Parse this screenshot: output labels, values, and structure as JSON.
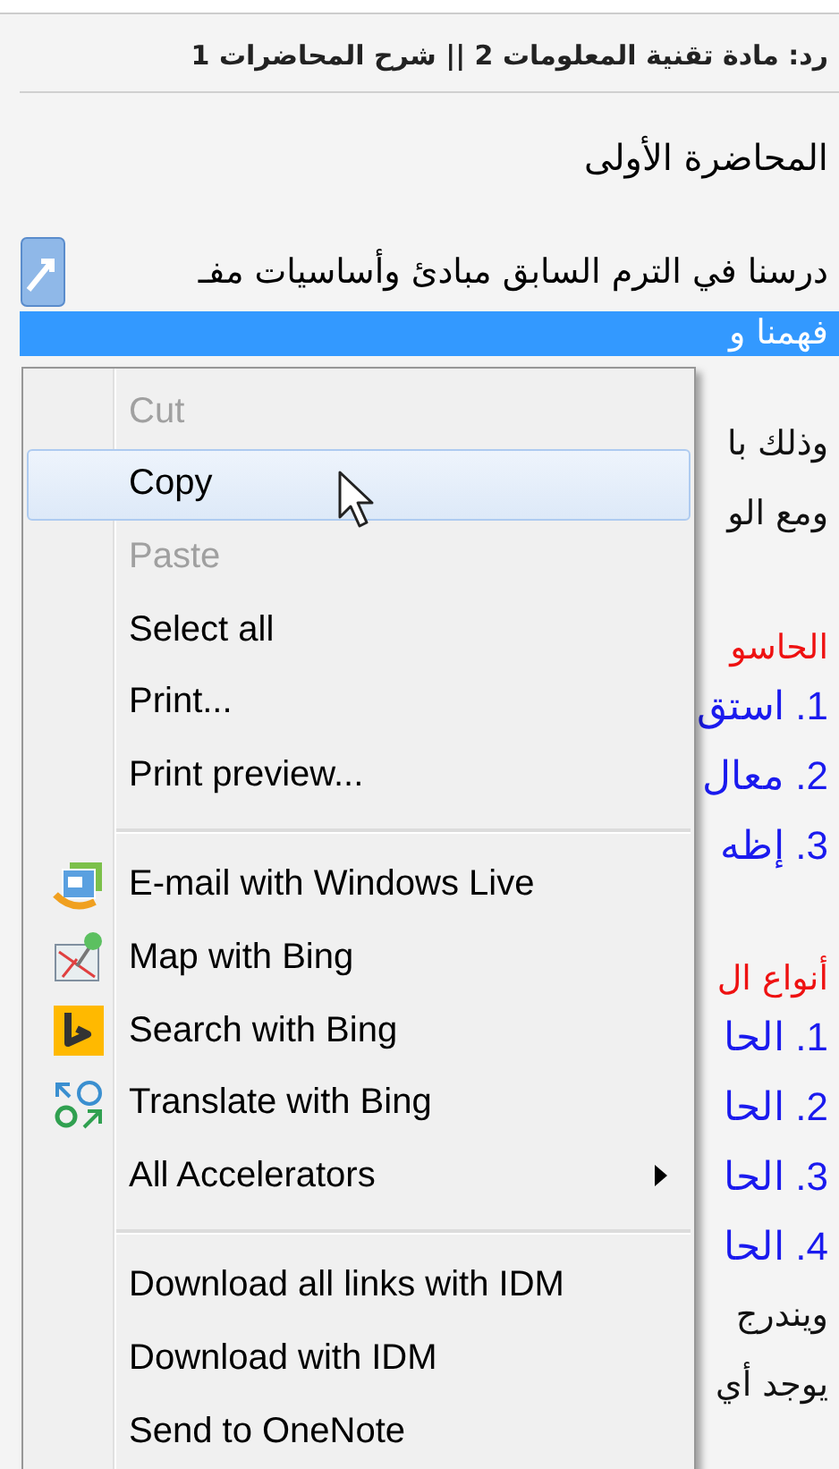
{
  "thread_title": "رد: مادة تقنية المعلومات 2 || شرح المحاضرات 1",
  "post": {
    "heading": "المحاضرة الأولى",
    "line": "درسنا في الترم السابق مبادئ وأساسيات مفـ",
    "selected_line": "فهمنا و",
    "fragments": [
      {
        "kind": "text",
        "text": "وذلك با"
      },
      {
        "kind": "text",
        "text": "ومع الو"
      },
      {
        "kind": "heading",
        "text": "الحاسو"
      },
      {
        "kind": "item",
        "text": "1. استق"
      },
      {
        "kind": "item",
        "text": "2. معال"
      },
      {
        "kind": "item",
        "text": "3. إظه"
      },
      {
        "kind": "heading",
        "text": "أنواع ال"
      },
      {
        "kind": "item",
        "text": "1. الحا"
      },
      {
        "kind": "item",
        "text": "2. الحا"
      },
      {
        "kind": "item",
        "text": "3. الحا"
      },
      {
        "kind": "item",
        "text": "4. الحا"
      },
      {
        "kind": "text",
        "text": "ويندرج"
      },
      {
        "kind": "text",
        "text": "يوجد أي"
      }
    ]
  },
  "context_menu": {
    "items": [
      {
        "kind": "command",
        "label": "Cut",
        "disabled": true,
        "selected": false
      },
      {
        "kind": "command",
        "label": "Copy",
        "disabled": false,
        "selected": true
      },
      {
        "kind": "command",
        "label": "Paste",
        "disabled": true,
        "selected": false
      },
      {
        "kind": "command",
        "label": "Select all",
        "disabled": false,
        "selected": false
      },
      {
        "kind": "command",
        "label": "Print...",
        "disabled": false,
        "selected": false
      },
      {
        "kind": "command",
        "label": "Print preview...",
        "disabled": false,
        "selected": false
      },
      {
        "kind": "separator"
      },
      {
        "kind": "command",
        "label": "E-mail with Windows Live",
        "disabled": false,
        "selected": false
      },
      {
        "kind": "command",
        "label": "Map with Bing",
        "disabled": false,
        "selected": false
      },
      {
        "kind": "command",
        "label": "Search with Bing",
        "disabled": false,
        "selected": false
      },
      {
        "kind": "command",
        "label": "Translate with Bing",
        "disabled": false,
        "selected": false
      },
      {
        "kind": "submenu",
        "label": "All Accelerators",
        "disabled": false,
        "selected": false
      },
      {
        "kind": "separator"
      },
      {
        "kind": "command",
        "label": "Download all links with IDM",
        "disabled": false,
        "selected": false
      },
      {
        "kind": "command",
        "label": "Download with IDM",
        "disabled": false,
        "selected": false
      },
      {
        "kind": "command",
        "label": "Send to OneNote",
        "disabled": false,
        "selected": false
      }
    ]
  }
}
